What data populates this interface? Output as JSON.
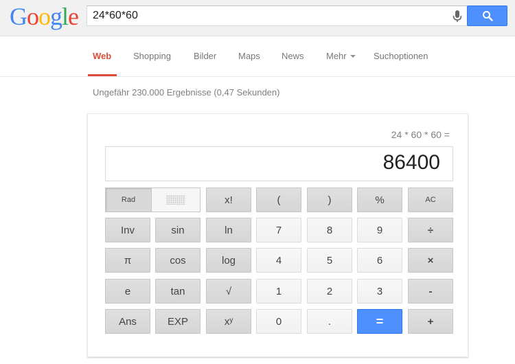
{
  "logo": {
    "letters": [
      "G",
      "o",
      "o",
      "g",
      "l",
      "e"
    ],
    "colors": [
      "#4285f4",
      "#ea4335",
      "#fbbc05",
      "#4285f4",
      "#34a853",
      "#ea4335"
    ]
  },
  "search": {
    "query": "24*60*60"
  },
  "nav": {
    "web": "Web",
    "shopping": "Shopping",
    "bilder": "Bilder",
    "maps": "Maps",
    "news": "News",
    "mehr": "Mehr",
    "suchoptionen": "Suchoptionen"
  },
  "stats": "Ungefähr 230.000 Ergebnisse (0,47 Sekunden)",
  "calculator": {
    "expression": "24 * 60 * 60 =",
    "result": "86400",
    "rad": "Rad",
    "keys": {
      "fact": "x!",
      "lparen": "(",
      "rparen": ")",
      "percent": "%",
      "ac": "AC",
      "inv": "Inv",
      "sin": "sin",
      "ln": "ln",
      "n7": "7",
      "n8": "8",
      "n9": "9",
      "div": "÷",
      "pi": "π",
      "cos": "cos",
      "log": "log",
      "n4": "4",
      "n5": "5",
      "n6": "6",
      "mul": "×",
      "e": "e",
      "tan": "tan",
      "sqrt": "√",
      "n1": "1",
      "n2": "2",
      "n3": "3",
      "minus": "-",
      "ans": "Ans",
      "exp": "EXP",
      "pow": "xʸ",
      "n0": "0",
      "dot": ".",
      "equals": "=",
      "plus": "+"
    }
  },
  "colors": {
    "accent": "#dd4b39",
    "button_blue": "#4d90fe"
  }
}
